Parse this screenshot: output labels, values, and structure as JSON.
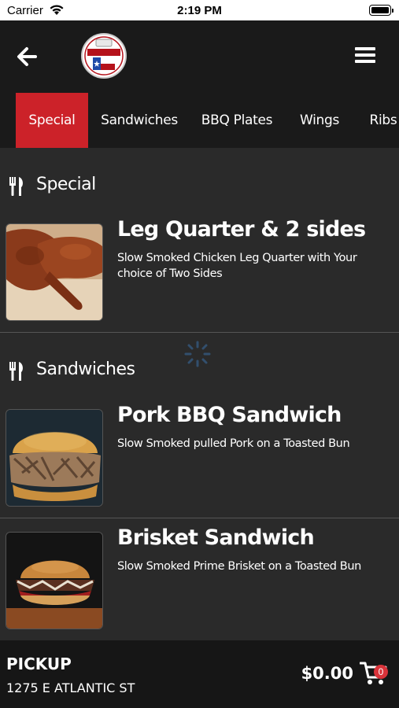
{
  "status_bar": {
    "carrier": "Carrier",
    "time": "2:19 PM"
  },
  "header": {
    "back_icon": "arrow-left-icon",
    "logo_icon": "restaurant-logo",
    "menu_icon": "hamburger-icon"
  },
  "tabs": [
    {
      "label": "Special",
      "active": true
    },
    {
      "label": "Sandwiches",
      "active": false
    },
    {
      "label": "BBQ Plates",
      "active": false
    },
    {
      "label": "Wings",
      "active": false
    },
    {
      "label": "Ribs",
      "active": false
    }
  ],
  "sections": [
    {
      "title": "Special",
      "items": [
        {
          "name": "Leg Quarter & 2 sides",
          "description": "Slow Smoked Chicken Leg Quarter with Your choice of Two Sides"
        }
      ]
    },
    {
      "title": "Sandwiches",
      "items": [
        {
          "name": "Pork BBQ Sandwich",
          "description": "Slow Smoked pulled Pork on a Toasted Bun"
        },
        {
          "name": "Brisket Sandwich",
          "description": "Slow Smoked Prime Brisket on a Toasted Bun"
        }
      ]
    }
  ],
  "footer": {
    "mode": "PICKUP",
    "address": "1275 E ATLANTIC ST",
    "total": "$0.00",
    "cart_count": "0",
    "cart_icon": "cart-icon"
  },
  "colors": {
    "accent": "#cc2229",
    "background": "#2a2a2a",
    "header": "#1a1a1a",
    "badge": "#d9333a"
  }
}
